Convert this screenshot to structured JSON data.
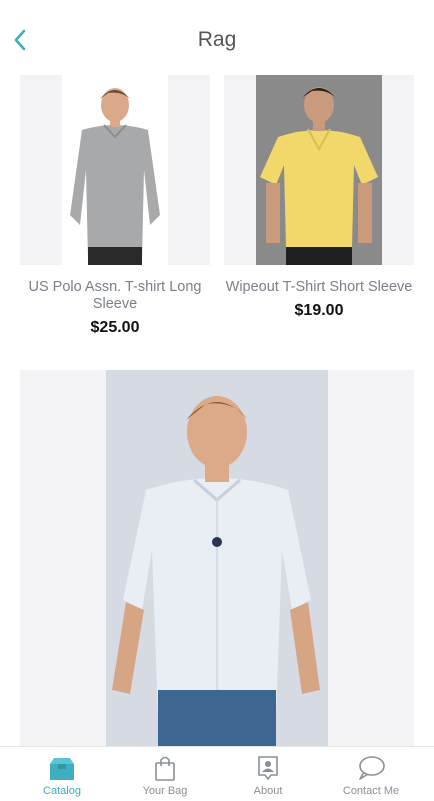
{
  "header": {
    "title": "Rag"
  },
  "products": [
    {
      "name": "US Polo Assn. T-shirt Long Sleeve",
      "price": "$25.00",
      "image": "grey-long-sleeve-polo"
    },
    {
      "name": "Wipeout T-Shirt Short Sleeve",
      "price": "$19.00",
      "image": "yellow-short-sleeve-polo"
    },
    {
      "name": "",
      "price": "",
      "image": "light-blue-button-down-shirt"
    }
  ],
  "tabs": [
    {
      "label": "Catalog",
      "icon": "box-icon",
      "active": true
    },
    {
      "label": "Your Bag",
      "icon": "bag-icon",
      "active": false
    },
    {
      "label": "About",
      "icon": "person-badge-icon",
      "active": false
    },
    {
      "label": "Contact Me",
      "icon": "chat-bubble-icon",
      "active": false
    }
  ],
  "colors": {
    "accent": "#3eaec0",
    "text_muted": "#7a7f8a",
    "placeholder_bg": "#f3f3f5"
  }
}
